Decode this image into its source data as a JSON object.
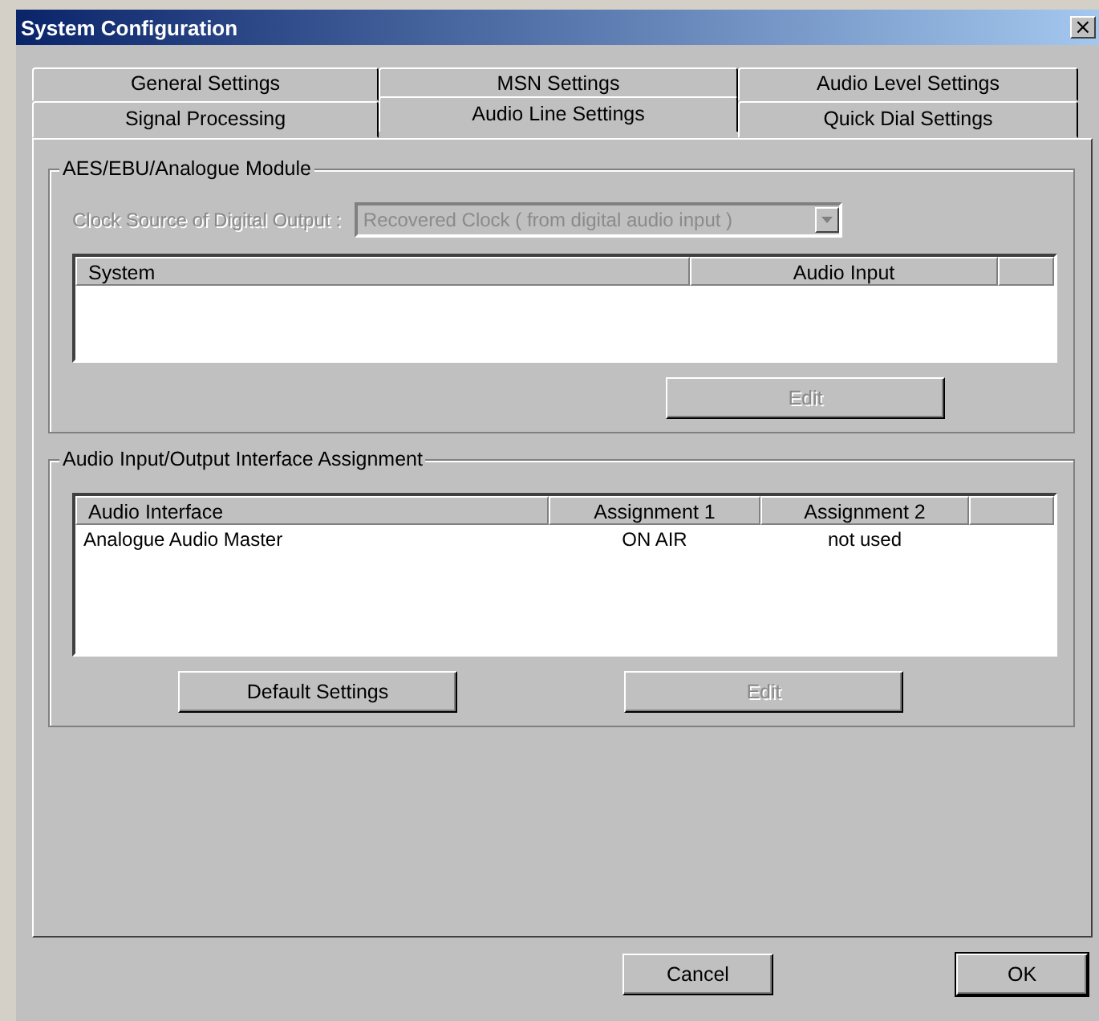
{
  "window": {
    "title": "System Configuration",
    "close": "×"
  },
  "tab_rows": [
    [
      {
        "label": "General Settings",
        "selected": false
      },
      {
        "label": "MSN Settings",
        "selected": false
      },
      {
        "label": "Audio Level Settings",
        "selected": false
      }
    ],
    [
      {
        "label": "Signal Processing",
        "selected": false
      },
      {
        "label": "Audio Line Settings",
        "selected": true
      },
      {
        "label": "Quick Dial Settings",
        "selected": false
      }
    ]
  ],
  "aes_module": {
    "title": "AES/EBU/Analogue Module",
    "clock_label": "Clock Source of Digital Output :",
    "clock_value": "Recovered Clock ( from digital audio input )",
    "clock_disabled": true,
    "table": {
      "columns": [
        "System",
        "Audio Input"
      ]
    },
    "edit_button": {
      "label": "Edit",
      "disabled": true
    }
  },
  "interface_assignment": {
    "title": "Audio Input/Output Interface Assignment",
    "table": {
      "columns": [
        "Audio Interface",
        "Assignment 1",
        "Assignment 2"
      ],
      "rows": [
        [
          "Analogue Audio Master",
          "ON AIR",
          "not used"
        ]
      ]
    },
    "default_button": {
      "label": "Default Settings",
      "disabled": false
    },
    "edit_button": {
      "label": "Edit",
      "disabled": true
    }
  },
  "buttons": [
    {
      "label": "Cancel",
      "default": false
    },
    {
      "label": "OK",
      "default": true
    }
  ]
}
